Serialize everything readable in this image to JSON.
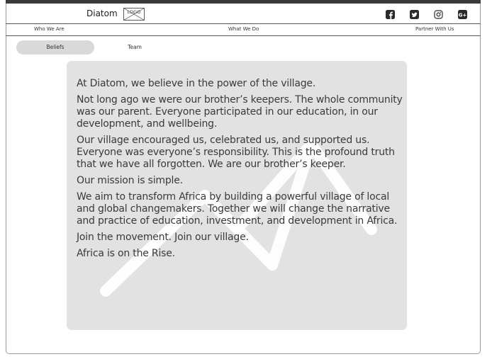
{
  "header": {
    "brand_name": "Diatom",
    "logo_text": "LOGO",
    "social_icons": [
      "facebook-icon",
      "twitter-icon",
      "instagram-icon",
      "google-plus-icon"
    ]
  },
  "nav": {
    "items": [
      {
        "label": "Who We Are"
      },
      {
        "label": "What We Do"
      },
      {
        "label": "Partner With Us"
      }
    ]
  },
  "tabs": {
    "items": [
      {
        "label": "Beliefs",
        "active": true
      },
      {
        "label": "Team",
        "active": false
      }
    ]
  },
  "main": {
    "paragraphs": [
      "At Diatom, we believe in the power of the village.",
      "Not long ago we were our brother’s keepers. The whole community was our parent. Everyone participated in our education, in our development, and wellbeing.",
      "Our village encouraged us, celebrated us, and supported us. Everyone was everyone’s responsibility. This is the profound truth that we have all forgotten. We are our brother’s keeper.",
      "Our mission is simple.",
      "We aim to transform Africa by building a powerful village of local and global changemakers. Together we will change the narrative and practice of education, investment, and development in Africa.",
      "Join the movement. Join our village.",
      "Africa is on the Rise."
    ]
  },
  "colors": {
    "card_background": "#e2e2e2",
    "active_tab": "#d9d9d9",
    "top_bar": "#3a3a3a",
    "watermark": "#ffffff"
  }
}
